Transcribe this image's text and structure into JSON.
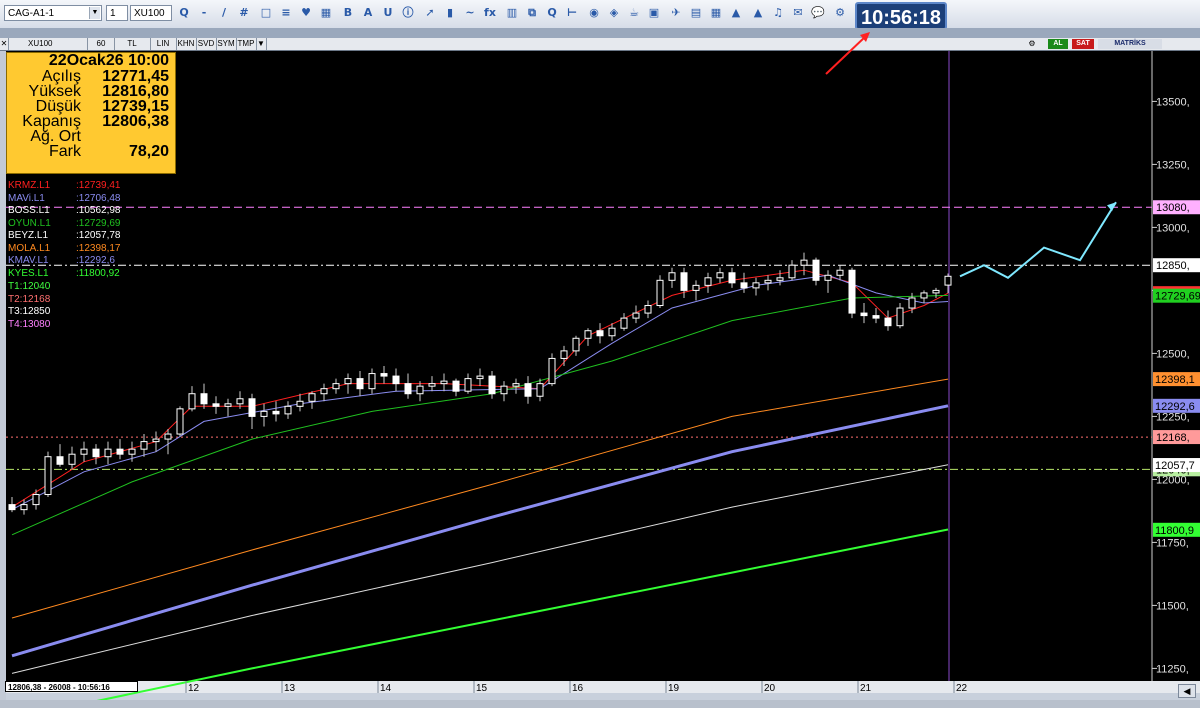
{
  "toolbar": {
    "workspace": "CAG-A1-1",
    "period": "1",
    "symbol": "XU100",
    "icons": [
      "zoom-icon",
      "minus-icon",
      "line-icon",
      "grid-icon",
      "monitor-icon",
      "table-icon",
      "heart-icon",
      "chart-icon",
      "bold-b-icon",
      "alarm-a-icon",
      "underline-u-icon",
      "info-icon",
      "arrow-icon",
      "candle-icon",
      "curve-icon",
      "fx-icon",
      "bar-icon",
      "copy-icon",
      "zoom2-icon",
      "ruler-icon",
      "tag-icon",
      "tag2-icon",
      "cup-icon",
      "save-icon",
      "bird-icon",
      "box-icon",
      "grid2-icon",
      "triangle-icon",
      "triangle2-icon",
      "bell-icon",
      "mail-icon",
      "chat-icon",
      "gear-icon"
    ],
    "icon_glyphs": [
      "Q",
      "-",
      "/",
      "#",
      "□",
      "≡",
      "♥",
      "▦",
      "B",
      "A",
      "U",
      "ⓘ",
      "➚",
      "▮",
      "~",
      "fx",
      "▥",
      "⧉",
      "Q",
      "⊢",
      "◉",
      "◈",
      "☕",
      "▣",
      "✈",
      "▤",
      "▦",
      "▲",
      "▲",
      "♫",
      "✉",
      "💬",
      "⚙"
    ],
    "clock": "10:56:18"
  },
  "chart_header": {
    "symbol": "XU100",
    "period": "60",
    "currency": "TL",
    "scale_buttons": [
      "LIN",
      "KHN",
      "SVD",
      "SYM",
      "TMP"
    ],
    "right_buttons": {
      "b1": "AL",
      "b2": "SAT",
      "brand": "MATRİKS"
    }
  },
  "ohlc_box": {
    "title": "22Ocak26 10:00",
    "rows": [
      {
        "label": "Açılış",
        "value": "12771,45"
      },
      {
        "label": "Yüksek",
        "value": "12816,80"
      },
      {
        "label": "Düşük",
        "value": "12739,15"
      },
      {
        "label": "Kapanış",
        "value": "12806,38"
      },
      {
        "label": "Ağ. Ort",
        "value": ""
      },
      {
        "label": "Fark",
        "value": "78,20"
      }
    ]
  },
  "indicators": [
    {
      "name": "KRMZ.L1",
      "value": ":12739,41",
      "color": "#ff2020"
    },
    {
      "name": "MAVi.L1",
      "value": ":12706,48",
      "color": "#8a8cf0"
    },
    {
      "name": "BOSS.L1",
      "value": ":10562,98",
      "color": "#ffffff"
    },
    {
      "name": "OYUN.L1",
      "value": ":12729,69",
      "color": "#20c020"
    },
    {
      "name": "BEYZ.L1",
      "value": ":12057,78",
      "color": "#ffffff"
    },
    {
      "name": "MOLA.L1",
      "value": ":12398,17",
      "color": "#ff8a20"
    },
    {
      "name": "KMAV.L1",
      "value": ":12292,6",
      "color": "#8a8cf0"
    },
    {
      "name": "KYES.L1",
      "value": ":11800,92",
      "color": "#33ff33"
    }
  ],
  "targets": [
    {
      "label": "T1:12040",
      "color": "#40ff40"
    },
    {
      "label": "T2:12168",
      "color": "#ff7070"
    },
    {
      "label": "T3:12850",
      "color": "#ffffff"
    },
    {
      "label": "T4:13080",
      "color": "#ff80ff"
    }
  ],
  "bottom_info": "12806,38 - 26008 - 10:56:16",
  "colors": {
    "candle_up": "#ffffff",
    "candle_down": "#ffffff",
    "wick": "#cccccc",
    "krmz": "#ff2020",
    "mavi": "#8a8cf0",
    "oyun": "#20c020",
    "mola": "#ff8a20",
    "kmav": "#8a8cf0",
    "beyz": "#dddddd",
    "kyes": "#33ff33",
    "forecast": "#7fe8ff",
    "level_t4": "#ff80ff",
    "level_t3": "#ffffff",
    "level_t2": "#ff7070",
    "level_t1": "#b8e86a",
    "vline": "#8a4acb",
    "arrow": "#ff2020"
  },
  "chart_data": {
    "type": "candlestick",
    "title": "",
    "xlabel": "",
    "ylabel": "",
    "ylim": [
      11200,
      13700
    ],
    "y_ticks": [
      11250,
      11500,
      11750,
      12000,
      12250,
      12500,
      12750,
      13000,
      13250,
      13500
    ],
    "y_tick_labels": [
      "11250,",
      "11500,",
      "11750,",
      "12000,",
      "12250,",
      "12500,",
      "12750,",
      "13000,",
      "13250,",
      "13500,"
    ],
    "x_labels": [
      "12",
      "13",
      "14",
      "15",
      "16",
      "19",
      "20",
      "21",
      "22"
    ],
    "x_label_index": [
      14.5,
      22.5,
      30.5,
      38.5,
      46.5,
      54.5,
      62.5,
      70.5,
      78.5
    ],
    "candles": [
      [
        11900,
        11930,
        11870,
        11880
      ],
      [
        11880,
        11920,
        11860,
        11900
      ],
      [
        11900,
        11960,
        11880,
        11940
      ],
      [
        11940,
        12110,
        11930,
        12090
      ],
      [
        12090,
        12140,
        12050,
        12060
      ],
      [
        12060,
        12130,
        12040,
        12100
      ],
      [
        12100,
        12150,
        12070,
        12120
      ],
      [
        12120,
        12140,
        12060,
        12090
      ],
      [
        12090,
        12150,
        12060,
        12120
      ],
      [
        12120,
        12160,
        12080,
        12100
      ],
      [
        12100,
        12150,
        12070,
        12120
      ],
      [
        12120,
        12180,
        12090,
        12150
      ],
      [
        12150,
        12190,
        12110,
        12160
      ],
      [
        12160,
        12200,
        12100,
        12180
      ],
      [
        12180,
        12290,
        12170,
        12280
      ],
      [
        12280,
        12370,
        12270,
        12340
      ],
      [
        12340,
        12380,
        12280,
        12300
      ],
      [
        12300,
        12330,
        12260,
        12290
      ],
      [
        12290,
        12320,
        12250,
        12300
      ],
      [
        12300,
        12350,
        12280,
        12320
      ],
      [
        12320,
        12340,
        12200,
        12250
      ],
      [
        12250,
        12300,
        12210,
        12270
      ],
      [
        12270,
        12310,
        12230,
        12260
      ],
      [
        12260,
        12310,
        12240,
        12290
      ],
      [
        12290,
        12340,
        12270,
        12310
      ],
      [
        12310,
        12350,
        12280,
        12340
      ],
      [
        12340,
        12380,
        12310,
        12360
      ],
      [
        12360,
        12400,
        12340,
        12380
      ],
      [
        12380,
        12420,
        12340,
        12400
      ],
      [
        12400,
        12430,
        12330,
        12360
      ],
      [
        12360,
        12440,
        12340,
        12420
      ],
      [
        12420,
        12450,
        12380,
        12410
      ],
      [
        12410,
        12440,
        12350,
        12380
      ],
      [
        12380,
        12420,
        12320,
        12340
      ],
      [
        12340,
        12390,
        12310,
        12370
      ],
      [
        12370,
        12410,
        12350,
        12380
      ],
      [
        12380,
        12420,
        12350,
        12390
      ],
      [
        12390,
        12400,
        12330,
        12350
      ],
      [
        12350,
        12420,
        12340,
        12400
      ],
      [
        12400,
        12440,
        12370,
        12410
      ],
      [
        12410,
        12430,
        12320,
        12340
      ],
      [
        12340,
        12390,
        12310,
        12370
      ],
      [
        12370,
        12400,
        12340,
        12380
      ],
      [
        12380,
        12410,
        12300,
        12330
      ],
      [
        12330,
        12400,
        12310,
        12380
      ],
      [
        12380,
        12500,
        12370,
        12480
      ],
      [
        12480,
        12530,
        12450,
        12510
      ],
      [
        12510,
        12570,
        12490,
        12560
      ],
      [
        12560,
        12600,
        12530,
        12590
      ],
      [
        12590,
        12620,
        12540,
        12570
      ],
      [
        12570,
        12620,
        12550,
        12600
      ],
      [
        12600,
        12660,
        12590,
        12640
      ],
      [
        12640,
        12690,
        12620,
        12660
      ],
      [
        12660,
        12710,
        12640,
        12690
      ],
      [
        12690,
        12810,
        12680,
        12790
      ],
      [
        12790,
        12840,
        12760,
        12820
      ],
      [
        12820,
        12840,
        12720,
        12750
      ],
      [
        12750,
        12790,
        12710,
        12770
      ],
      [
        12770,
        12820,
        12740,
        12800
      ],
      [
        12800,
        12840,
        12780,
        12820
      ],
      [
        12820,
        12840,
        12760,
        12780
      ],
      [
        12780,
        12820,
        12740,
        12760
      ],
      [
        12760,
        12800,
        12730,
        12780
      ],
      [
        12780,
        12810,
        12750,
        12790
      ],
      [
        12790,
        12830,
        12770,
        12800
      ],
      [
        12800,
        12870,
        12790,
        12850
      ],
      [
        12850,
        12900,
        12810,
        12870
      ],
      [
        12870,
        12880,
        12770,
        12790
      ],
      [
        12790,
        12830,
        12740,
        12810
      ],
      [
        12810,
        12850,
        12790,
        12830
      ],
      [
        12830,
        12840,
        12640,
        12660
      ],
      [
        12660,
        12700,
        12620,
        12650
      ],
      [
        12650,
        12680,
        12620,
        12640
      ],
      [
        12640,
        12670,
        12590,
        12610
      ],
      [
        12610,
        12700,
        12600,
        12680
      ],
      [
        12680,
        12740,
        12660,
        12720
      ],
      [
        12720,
        12750,
        12700,
        12740
      ],
      [
        12740,
        12760,
        12720,
        12750
      ],
      [
        12771,
        12817,
        12739,
        12806
      ]
    ],
    "series": [
      {
        "name": "KRMZ.L1",
        "values": [
          [
            0,
            11890
          ],
          [
            6,
            12070
          ],
          [
            12,
            12150
          ],
          [
            15,
            12290
          ],
          [
            20,
            12290
          ],
          [
            28,
            12380
          ],
          [
            36,
            12380
          ],
          [
            44,
            12360
          ],
          [
            48,
            12570
          ],
          [
            55,
            12730
          ],
          [
            60,
            12790
          ],
          [
            66,
            12830
          ],
          [
            70,
            12780
          ],
          [
            73,
            12640
          ],
          [
            76,
            12690
          ],
          [
            78,
            12739
          ]
        ]
      },
      {
        "name": "MAVi.L1",
        "values": [
          [
            0,
            11880
          ],
          [
            6,
            12030
          ],
          [
            12,
            12110
          ],
          [
            16,
            12230
          ],
          [
            24,
            12300
          ],
          [
            32,
            12350
          ],
          [
            44,
            12360
          ],
          [
            50,
            12540
          ],
          [
            55,
            12680
          ],
          [
            62,
            12770
          ],
          [
            68,
            12810
          ],
          [
            72,
            12740
          ],
          [
            76,
            12700
          ],
          [
            78,
            12706
          ]
        ]
      },
      {
        "name": "OYUN.L1",
        "values": [
          [
            0,
            11780
          ],
          [
            10,
            11990
          ],
          [
            20,
            12160
          ],
          [
            30,
            12270
          ],
          [
            40,
            12340
          ],
          [
            50,
            12470
          ],
          [
            60,
            12630
          ],
          [
            70,
            12720
          ],
          [
            78,
            12730
          ]
        ]
      },
      {
        "name": "MOLA.L1",
        "values": [
          [
            0,
            11450
          ],
          [
            20,
            11720
          ],
          [
            40,
            11980
          ],
          [
            60,
            12250
          ],
          [
            78,
            12398
          ]
        ]
      },
      {
        "name": "KMAV.L1",
        "values": [
          [
            0,
            11300
          ],
          [
            20,
            11580
          ],
          [
            40,
            11850
          ],
          [
            60,
            12110
          ],
          [
            78,
            12292
          ]
        ]
      },
      {
        "name": "BEYZ.L1",
        "values": [
          [
            0,
            11230
          ],
          [
            20,
            11460
          ],
          [
            40,
            11670
          ],
          [
            60,
            11890
          ],
          [
            78,
            12058
          ]
        ]
      },
      {
        "name": "KYES.L1",
        "values": [
          [
            0,
            11050
          ],
          [
            20,
            11250
          ],
          [
            40,
            11440
          ],
          [
            60,
            11630
          ],
          [
            78,
            11801
          ]
        ]
      }
    ],
    "forecast": [
      [
        79,
        12806
      ],
      [
        81,
        12850
      ],
      [
        83,
        12800
      ],
      [
        86,
        12920
      ],
      [
        89,
        12870
      ],
      [
        92,
        13100
      ]
    ],
    "levels": [
      {
        "value": 13080,
        "label": "13080,",
        "style": "dashed",
        "name": "T4"
      },
      {
        "value": 12850,
        "label": "12850,",
        "style": "dashdot",
        "name": "T3"
      },
      {
        "value": 12168,
        "label": "12168,",
        "style": "dotted",
        "name": "T2"
      },
      {
        "value": 12040,
        "label": "12040,",
        "style": "dashdot",
        "name": "T1"
      }
    ],
    "axis_tags": [
      {
        "value": 12739,
        "label": "12739,41",
        "bg": "#ff3030"
      },
      {
        "value": 12729,
        "label": "12729,69",
        "bg": "#20d020"
      },
      {
        "value": 12398,
        "label": "12398,1",
        "bg": "#ff9030"
      },
      {
        "value": 12292,
        "label": "12292,6",
        "bg": "#8a8cf0"
      },
      {
        "value": 12057,
        "label": "12057,7",
        "bg": "#ffffff"
      },
      {
        "value": 11800,
        "label": "11800,9",
        "bg": "#33ff33"
      }
    ]
  }
}
